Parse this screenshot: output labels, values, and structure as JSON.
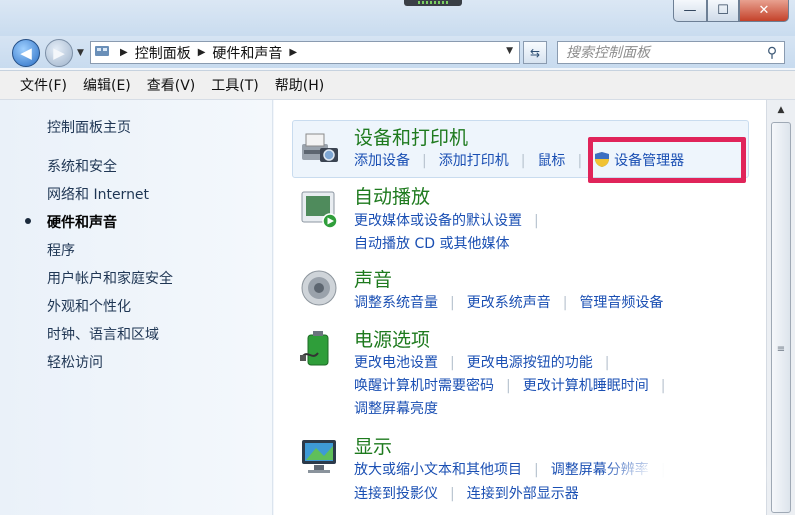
{
  "window": {
    "minimize_glyph": "—",
    "maximize_glyph": "☐",
    "close_glyph": "✕"
  },
  "address": {
    "crumbs": [
      "控制面板",
      "硬件和声音"
    ],
    "search_placeholder": "搜索控制面板"
  },
  "menu": [
    "文件(F)",
    "编辑(E)",
    "查看(V)",
    "工具(T)",
    "帮助(H)"
  ],
  "sidebar": {
    "home": "控制面板主页",
    "items": [
      {
        "label": "系统和安全"
      },
      {
        "label": "网络和 Internet"
      },
      {
        "label": "硬件和声音",
        "current": true
      },
      {
        "label": "程序"
      },
      {
        "label": "用户帐户和家庭安全"
      },
      {
        "label": "外观和个性化"
      },
      {
        "label": "时钟、语言和区域"
      },
      {
        "label": "轻松访问"
      }
    ]
  },
  "categories": {
    "devices": {
      "title": "设备和打印机",
      "links": [
        "添加设备",
        "添加打印机",
        "鼠标",
        "设备管理器"
      ]
    },
    "autoplay": {
      "title": "自动播放",
      "links_row1": [
        "更改媒体或设备的默认设置"
      ],
      "links_row2": [
        "自动播放 CD 或其他媒体"
      ]
    },
    "sound": {
      "title": "声音",
      "links": [
        "调整系统音量",
        "更改系统声音",
        "管理音频设备"
      ]
    },
    "power": {
      "title": "电源选项",
      "links_row1": [
        "更改电池设置",
        "更改电源按钮的功能"
      ],
      "links_row2": [
        "唤醒计算机时需要密码",
        "更改计算机睡眠时间"
      ],
      "links_row3": [
        "调整屏幕亮度"
      ]
    },
    "display": {
      "title": "显示",
      "links_row1": [
        "放大或缩小文本和其他项目",
        "调整屏幕分辨率"
      ],
      "links_row2": [
        "连接到投影仪",
        "连接到外部显示器"
      ]
    }
  },
  "colors": {
    "category_title": "#1e7a1e",
    "link": "#1a4fb3",
    "highlight_border": "#e0245a"
  }
}
